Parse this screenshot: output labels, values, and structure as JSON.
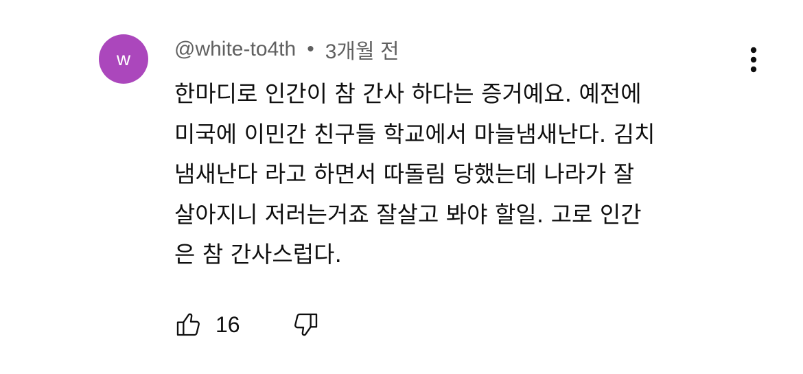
{
  "comment": {
    "avatar_letter": "w",
    "avatar_color": "#ab47bc",
    "author": "@white-to4th",
    "separator": "•",
    "time": "3개월 전",
    "lines": [
      "한마디로 인간이 참 간사 하다는 증거예요. 예전에",
      "미국에 이민간 친구들 학교에서 마늘냄새난다. 김치",
      "냄새난다 라고 하면서 따돌림 당했는데 나라가 잘",
      "살아지니 저러는거죠 잘살고 봐야 할일. 고로 인간",
      "은 참 간사스럽다."
    ],
    "like_count": "16",
    "icons": {
      "more": "more-vert-icon",
      "like": "thumbs-up-icon",
      "dislike": "thumbs-down-icon"
    }
  }
}
